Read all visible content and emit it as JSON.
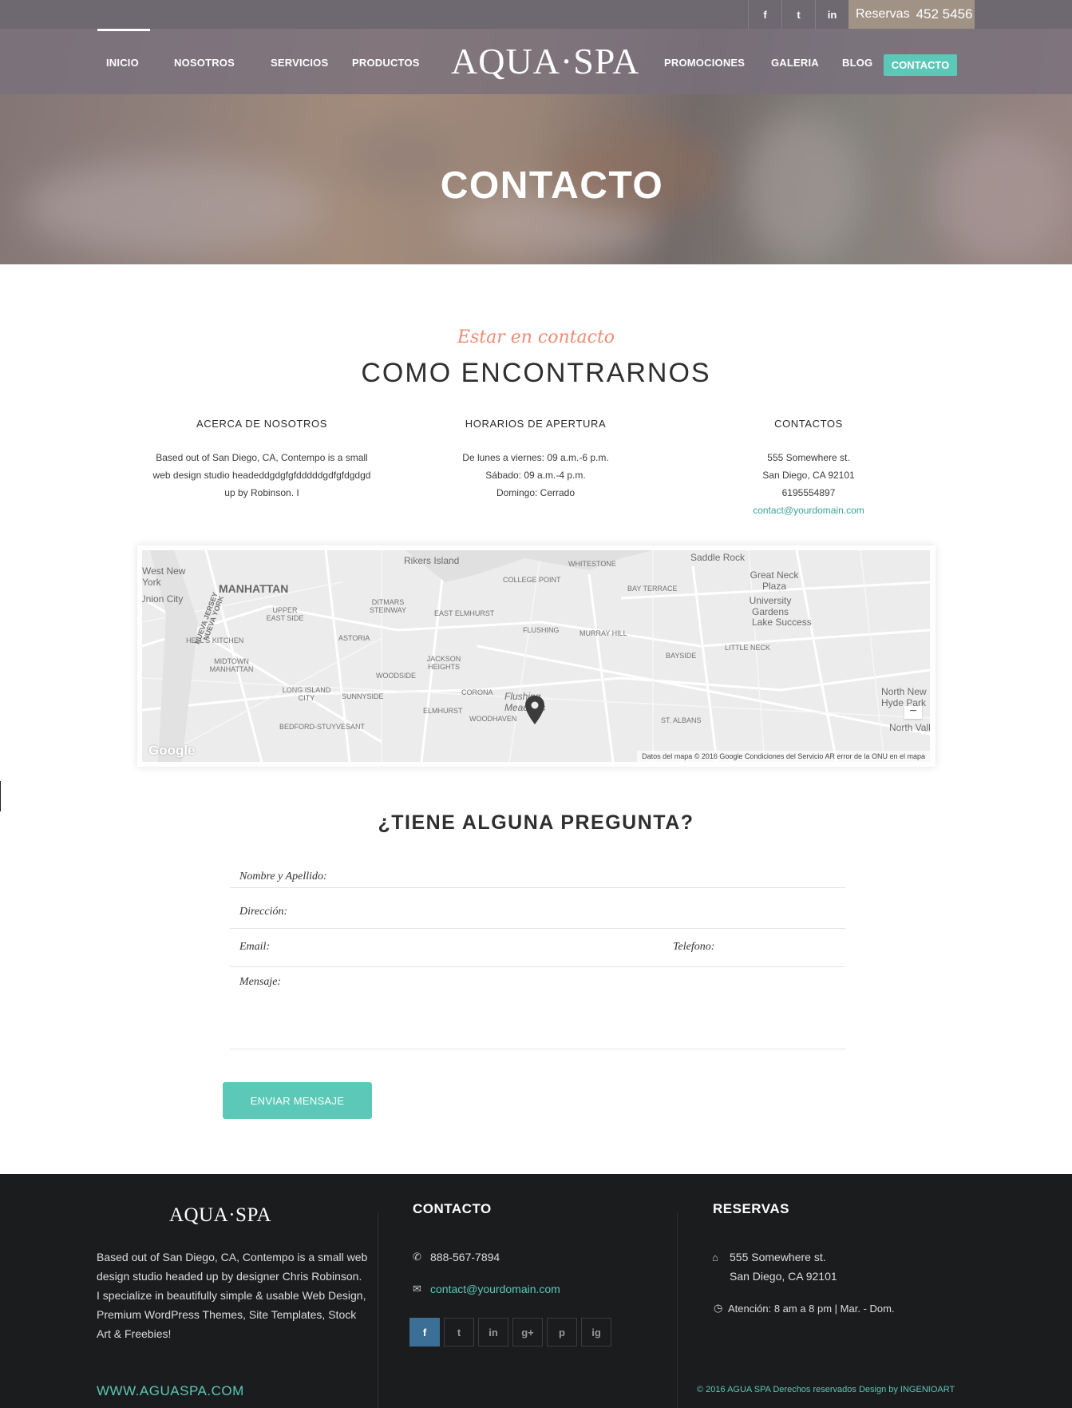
{
  "topbar": {
    "social": [
      "f",
      "t",
      "in"
    ],
    "reservas_label": "Reservas",
    "reservas_phone": "452 5456"
  },
  "nav": {
    "items_left": [
      "INICIO",
      "NOSOTROS",
      "SERVICIOS",
      "PRODUCTOS"
    ],
    "logo": "AQUA·SPA",
    "items_right": [
      "PROMOCIONES",
      "GALERIA",
      "BLOG"
    ],
    "contact": "CONTACTO"
  },
  "hero": {
    "title": "CONTACTO"
  },
  "section": {
    "script_title": "Estar en contacto",
    "title": "COMO ENCONTRARNOS",
    "columns": [
      {
        "heading": "ACERCA DE NOSOTROS",
        "lines": [
          "Based out of San Diego, CA, Contempo is a small",
          "web design studio headeddgdgfgfdddddgdfgfdgdgd",
          "up by Robinson. I"
        ]
      },
      {
        "heading": "HORARIOS DE APERTURA",
        "lines": [
          "De lunes a viernes: 09 a.m.-6 p.m.",
          "Sábado: 09 a.m.-4 p.m.",
          "Domingo: Cerrado"
        ]
      },
      {
        "heading": "CONTACTOS",
        "lines": [
          "555 Somewhere st.",
          "San Diego, CA 92101",
          "6195554897"
        ],
        "email": "contact@yourdomain.com"
      }
    ]
  },
  "map": {
    "labels": [
      "Rikers Island",
      "WHITESTONE",
      "Saddle Rock",
      "West New York",
      "MANHATTAN",
      "COLLEGE POINT",
      "Great Neck Plaza",
      "Union City",
      "NUEVA JERSEY",
      "NUEVA YORK",
      "DITMARS STEINWAY",
      "EAST ELMHURST",
      "BAY TERRACE",
      "University Gardens",
      "UPPER EAST SIDE",
      "Lake Success",
      "HELL'S KITCHEN",
      "ASTORIA",
      "FLUSHING",
      "MURRAY HILL",
      "LITTLE NECK",
      "JACKSON HEIGHTS",
      "BAYSIDE",
      "MIDTOWN MANHATTAN",
      "WOODSIDE",
      "CORONA",
      "Flushing Meadows",
      "LONG ISLAND CITY",
      "SUNNYSIDE",
      "ELMHURST",
      "North New Hyde Park",
      "WOODHAVEN",
      "BEDFORD-STUYVESANT",
      "ST. ALBANS",
      "North Valley"
    ],
    "google": "Google",
    "footer_text": "Datos del mapa © 2016 Google   Condiciones del Servicio   AR error de la ONU en el mapa",
    "zoom_out": "−"
  },
  "form": {
    "title": "¿TIENE ALGUNA PREGUNTA?",
    "name_placeholder": "Nombre y Apellido:",
    "address_placeholder": "Dirección:",
    "email_placeholder": "Email:",
    "phone_placeholder": "Telefono:",
    "message_placeholder": "Mensaje:",
    "submit": "ENVIAR MENSAJE"
  },
  "footer": {
    "logo": "AQUA·SPA",
    "about": "Based out of San Diego, CA, Contempo is a small web design studio headed up by designer Chris Robinson. I specialize in beautifully simple & usable Web Design, Premium WordPress Themes, Site Templates, Stock Art & Freebies!",
    "url": "WWW.AGUASPA.COM",
    "contact_heading": "CONTACTO",
    "phone": "888-567-7894",
    "email": "contact@yourdomain.com",
    "social": [
      "f",
      "t",
      "in",
      "g+",
      "p",
      "ig"
    ],
    "reservas_heading": "RESERVAS",
    "address_line1": "555 Somewhere st.",
    "address_line2": "San Diego, CA 92101",
    "hours": "Atención: 8 am a 8 pm  |  Mar. - Dom.",
    "copyright": "© 2016   AGUA SPA   Derechos reservados Design by INGENIOART"
  },
  "colors": {
    "accent": "#5cc8b7",
    "script": "#ec8d74",
    "footer_bg": "#1b1c1e",
    "facebook": "#3b6f96"
  }
}
